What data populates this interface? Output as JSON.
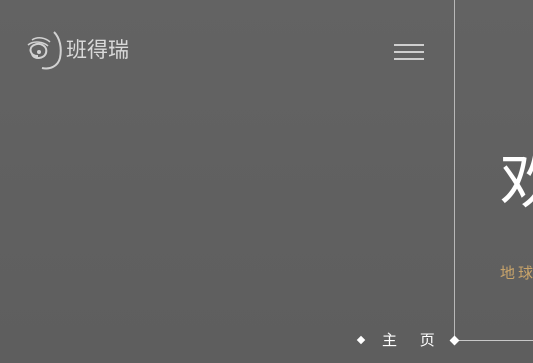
{
  "brand": {
    "logo_text": "班得瑞",
    "logo_icon": "swirl-logo-icon"
  },
  "header": {
    "menu_icon": "hamburger-menu-icon"
  },
  "hero": {
    "heading": "欢",
    "subtitle": "地球"
  },
  "nav": {
    "home_label": "主 页",
    "marker_icon": "diamond-icon"
  },
  "colors": {
    "background": "#606060",
    "text": "#ffffff",
    "accent": "#c9a46a",
    "lines": "#bfbfbf"
  }
}
